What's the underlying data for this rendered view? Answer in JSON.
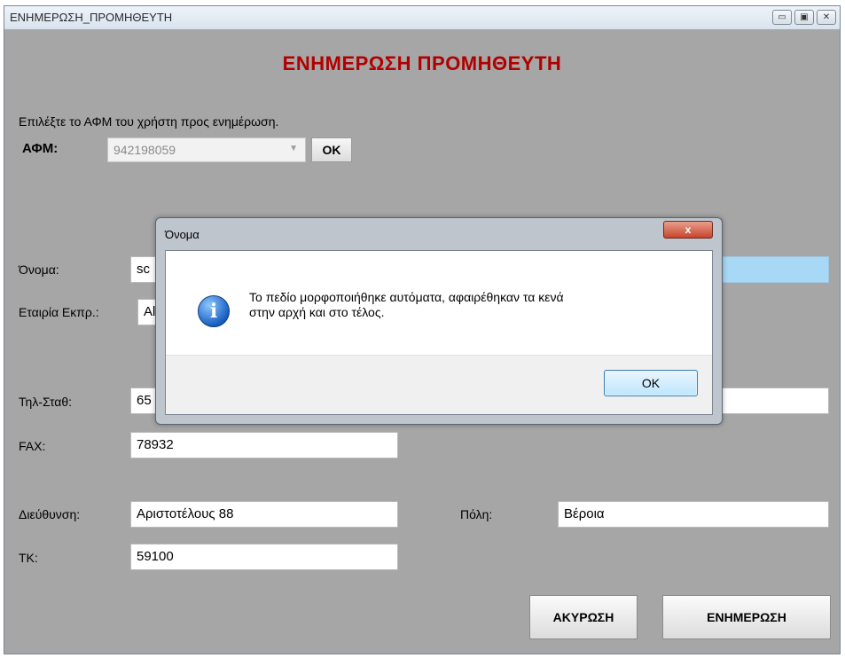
{
  "window": {
    "title": "ΕΝΗΜΕΡΩΣΗ_ΠΡΟΜΗΘΕΥΤΗ"
  },
  "heading": "ΕΝΗΜΕΡΩΣΗ ΠΡΟΜΗΘΕΥΤΗ",
  "instruction": "Επιλέξτε το ΑΦΜ του χρήστη προς ενημέρωση.",
  "afm": {
    "label": "ΑΦΜ:",
    "value": "942198059",
    "ok_label": "OK"
  },
  "fields": {
    "name": {
      "label": "Όνομα:",
      "value": "sc"
    },
    "company": {
      "label": "Εταιρία Εκπρ.:",
      "value": "Al"
    },
    "phone": {
      "label": "Τηλ-Σταθ:",
      "value": "65"
    },
    "fax": {
      "label": "FAX:",
      "value": "78932"
    },
    "address": {
      "label": "Διεύθυνση:",
      "value": "Αριστοτέλους 88"
    },
    "city": {
      "label": "Πόλη:",
      "value": "Βέροια"
    },
    "tk": {
      "label": "ΤΚ:",
      "value": "59100"
    }
  },
  "buttons": {
    "cancel": "ΑΚΥΡΩΣΗ",
    "update": "ΕΝΗΜΕΡΩΣΗ"
  },
  "dialog": {
    "title": "Όνομα",
    "close": "x",
    "message_line1": "Το πεδίο μορφοποιήθηκε αυτόματα, αφαιρέθηκαν τα κενά",
    "message_line2": "στην αρχή και στο τέλος.",
    "ok_label": "OK",
    "icon": "info-icon"
  },
  "colors": {
    "heading": "#b00000",
    "form_bg": "#a6a6a6",
    "highlight_field": "#a7d8f5"
  }
}
